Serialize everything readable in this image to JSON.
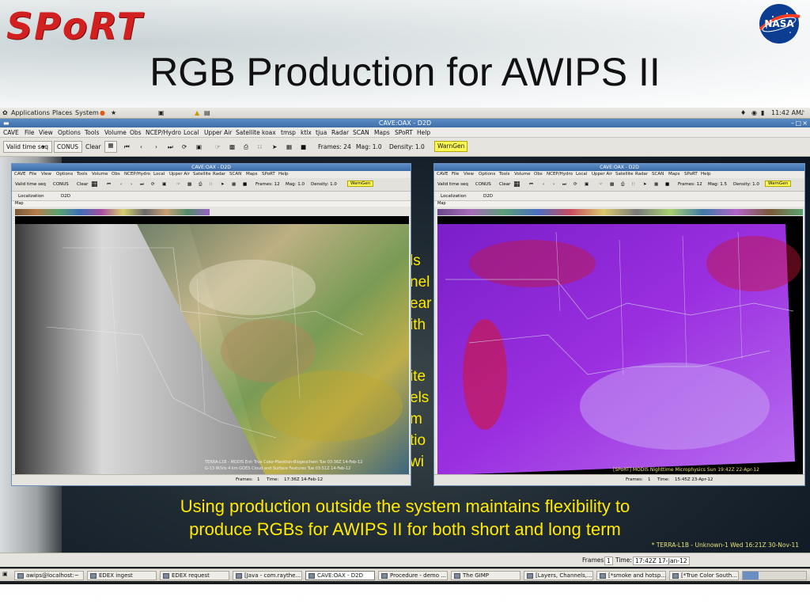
{
  "slide": {
    "title": "RGB Production for AWIPS II",
    "logo_left": "SPoRT",
    "logo_right": "NASA",
    "overlay_lines": [
      "Using production outside the system maintains flexibility to",
      "produce RGBs for AWIPS II for both short and long term"
    ],
    "overlay_credit": "* TERRA-L1B - Unknown-1  Wed 16:21Z 30-Nov-11",
    "hidden_text_fragments": [
      "ls",
      "nel",
      "ear",
      "ith",
      "ite",
      "els",
      "m",
      "tio",
      "wi"
    ]
  },
  "gnome_top": {
    "menus": [
      "Applications",
      "Places",
      "System"
    ],
    "clock": "11:42 AM"
  },
  "cave_main": {
    "title": "CAVE:OAX - D2D",
    "menus": [
      "CAVE",
      "File",
      "View",
      "Options",
      "Tools",
      "Volume",
      "Obs",
      "NCEP/Hydro",
      "Local",
      "Upper Air",
      "Satellite",
      "koax",
      "tmsp",
      "ktlx",
      "tjua",
      "Radar",
      "SCAN",
      "Maps",
      "SPoRT",
      "Help"
    ],
    "toolbar": {
      "time_mode": "Valid time seq",
      "scale": "CONUS",
      "clear": "Clear",
      "frames": "Frames: 24",
      "mag": "Mag: 1.0",
      "density": "Density: 1.0",
      "warngen": "WarnGen"
    },
    "status": {
      "frames_label": "Frames:",
      "frames_value": "1",
      "time_label": "Time:",
      "time_value": "17:42Z 17-Jan-12"
    }
  },
  "cave_left": {
    "title": "CAVE:OAX - D2D",
    "menus": [
      "CAVE",
      "File",
      "View",
      "Options",
      "Tools",
      "Volume",
      "Obs",
      "NCEP/Hydro",
      "Local",
      "Upper Air",
      "Satellite",
      "Radar",
      "SCAN",
      "Maps",
      "SPoRT",
      "Help"
    ],
    "toolbar": {
      "time_mode": "Valid time seq",
      "scale": "CONUS",
      "clear": "Clear",
      "frames": "Frames: 12",
      "mag": "Mag: 1.0",
      "density": "Density: 1.0",
      "warngen": "WarnGen"
    },
    "tabs": [
      "Localization",
      "D2D"
    ],
    "map_tab": "Map",
    "legend_1": "TERRA-L1B - MODIS Enh True Color-Plankton-Biogeochem   Tue 03:36Z 14-Feb-12",
    "legend_2": "G-13 IR/Vis 4 km  GOES Cloud and Surface Features   Tue 03:51Z 14-Feb-12",
    "status": {
      "frames_label": "Frames:",
      "frames_value": "1",
      "time_label": "Time:",
      "time_value": "17:36Z 14-Feb-12"
    }
  },
  "cave_right": {
    "title": "CAVE:OAX - D2D",
    "menus": [
      "CAVE",
      "File",
      "View",
      "Options",
      "Tools",
      "Volume",
      "Obs",
      "NCEP/Hydro",
      "Local",
      "Upper Air",
      "Satellite",
      "Radar",
      "SCAN",
      "Maps",
      "SPoRT",
      "Help"
    ],
    "toolbar": {
      "time_mode": "Valid time seq",
      "scale": "CONUS",
      "clear": "Clear",
      "frames": "Frames: 12",
      "mag": "Mag: 1.5",
      "density": "Density: 1.0",
      "warngen": "WarnGen"
    },
    "tabs": [
      "Localization",
      "D2D"
    ],
    "map_tab": "Map",
    "legend": "[SPoRT] MODIS Nighttime Microphysics  Sun 19:42Z 22-Apr-12",
    "status": {
      "frames_label": "Frames:",
      "frames_value": "1",
      "time_label": "Time:",
      "time_value": "15:45Z 23-Apr-12"
    }
  },
  "taskbar": [
    {
      "label": "awips@localhost:~",
      "active": false
    },
    {
      "label": "EDEX ingest",
      "active": false
    },
    {
      "label": "EDEX request",
      "active": false
    },
    {
      "label": "[Java - com.raythe...",
      "active": false
    },
    {
      "label": "CAVE:OAX - D2D",
      "active": true
    },
    {
      "label": "Procedure - demo ...",
      "active": false
    },
    {
      "label": "The GIMP",
      "active": false
    },
    {
      "label": "[Layers, Channels,...",
      "active": false
    },
    {
      "label": "[*smoke and hotsp...",
      "active": false
    },
    {
      "label": "[*True Color South...",
      "active": false
    }
  ],
  "colors": {
    "overlay_text": "#ffea00",
    "warngen_bg": "#fffb52",
    "titlebar": "#3f6fa8",
    "sport_red": "#d21f1f"
  }
}
